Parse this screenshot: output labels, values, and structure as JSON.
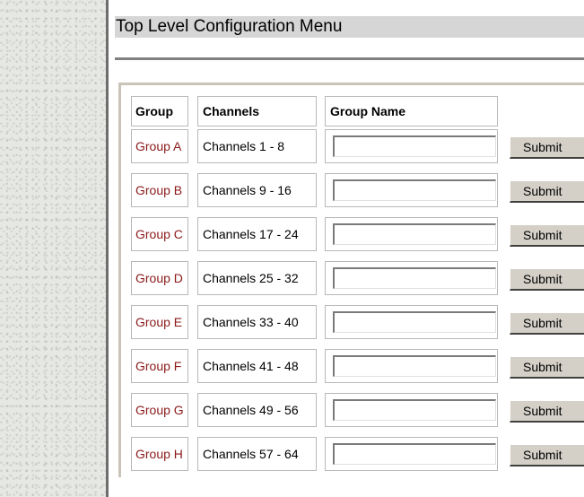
{
  "page": {
    "title": "Top Level Configuration Menu"
  },
  "table": {
    "headers": {
      "group": "Group",
      "channels": "Channels",
      "group_name": "Group Name"
    },
    "rows": [
      {
        "group": "Group A",
        "channels": "Channels 1 - 8",
        "group_name_value": "",
        "submit_label": "Submit"
      },
      {
        "group": "Group B",
        "channels": "Channels 9 - 16",
        "group_name_value": "",
        "submit_label": "Submit"
      },
      {
        "group": "Group C",
        "channels": "Channels 17 - 24",
        "group_name_value": "",
        "submit_label": "Submit"
      },
      {
        "group": "Group D",
        "channels": "Channels 25 - 32",
        "group_name_value": "",
        "submit_label": "Submit"
      },
      {
        "group": "Group E",
        "channels": "Channels 33 - 40",
        "group_name_value": "",
        "submit_label": "Submit"
      },
      {
        "group": "Group F",
        "channels": "Channels 41 - 48",
        "group_name_value": "",
        "submit_label": "Submit"
      },
      {
        "group": "Group G",
        "channels": "Channels 49 - 56",
        "group_name_value": "",
        "submit_label": "Submit"
      },
      {
        "group": "Group H",
        "channels": "Channels 57 - 64",
        "group_name_value": "",
        "submit_label": "Submit"
      }
    ]
  },
  "colors": {
    "group_link": "#8b1a1a",
    "title_bar": "#d6d6d6",
    "button_face": "#d4d0c8"
  }
}
